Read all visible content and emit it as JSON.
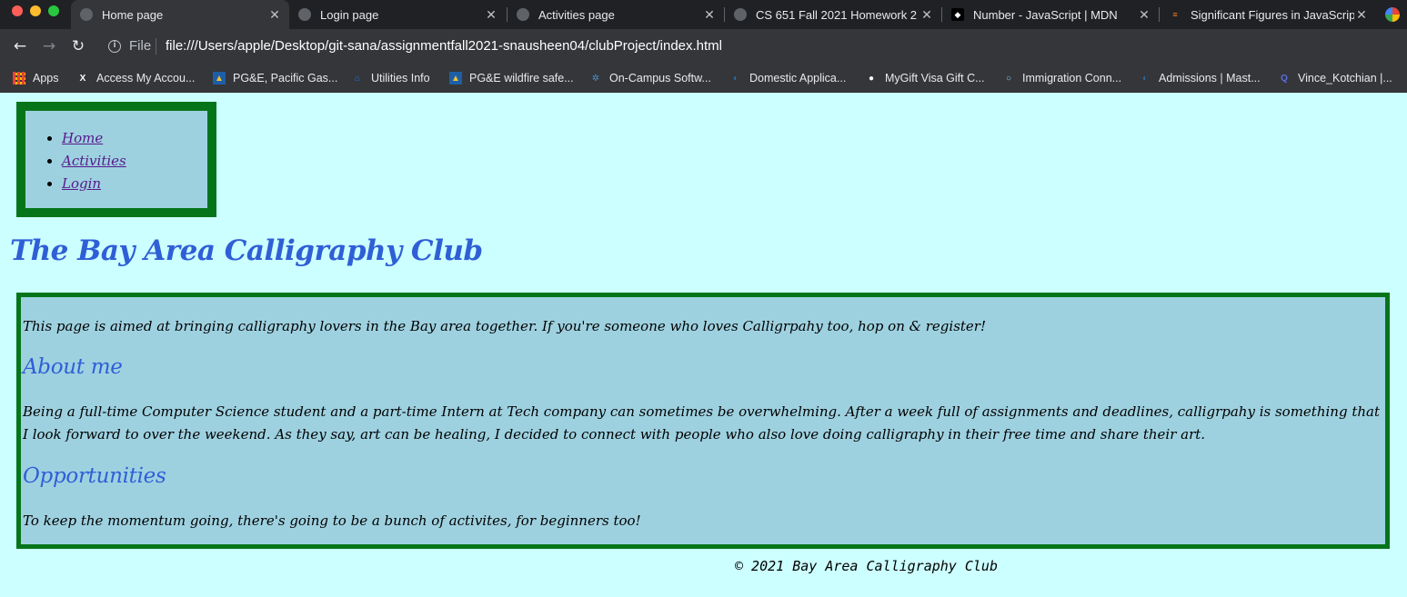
{
  "browser": {
    "tabs": [
      {
        "title": "Home page",
        "active": true
      },
      {
        "title": "Login page",
        "active": false
      },
      {
        "title": "Activities page",
        "active": false
      },
      {
        "title": "CS 651 Fall 2021 Homework 2",
        "active": false
      },
      {
        "title": "Number - JavaScript | MDN",
        "active": false
      },
      {
        "title": "Significant Figures in JavaScript",
        "active": false
      }
    ],
    "address": {
      "scheme_label": "File",
      "url": "file:///Users/apple/Desktop/git-sana/assignmentfall2021-snausheen04/clubProject/index.html"
    },
    "bookmarks": [
      {
        "label": "Apps",
        "icon": "apps-grid-icon"
      },
      {
        "label": "Access My Accou...",
        "icon": "x-logo-icon"
      },
      {
        "label": "PG&E, Pacific Gas...",
        "icon": "pge-icon"
      },
      {
        "label": "Utilities Info",
        "icon": "house-icon"
      },
      {
        "label": "PG&E wildfire safe...",
        "icon": "pge-icon"
      },
      {
        "label": "On-Campus Softw...",
        "icon": "network-icon"
      },
      {
        "label": "Domestic Applica...",
        "icon": "agency-logo-icon"
      },
      {
        "label": "MyGift Visa Gift C...",
        "icon": "globe-icon"
      },
      {
        "label": "Immigration Conn...",
        "icon": "circle-logo-icon"
      },
      {
        "label": "Admissions | Mast...",
        "icon": "agency-logo-icon"
      },
      {
        "label": "Vince_Kotchian |...",
        "icon": "q-logo-icon"
      }
    ]
  },
  "nav": {
    "items": [
      "Home",
      "Activities",
      "Login"
    ]
  },
  "site": {
    "title": "The Bay Area Calligraphy Club"
  },
  "main": {
    "intro": "This page is aimed at bringing calligraphy lovers in the Bay area together. If you're someone who loves Calligrpahy too, hop on & register!",
    "about_heading": "About me",
    "about_text": "Being a full-time Computer Science student and a part-time Intern at Tech company can sometimes be overwhelming. After a week full of assignments and deadlines, calligrpahy is something that I look forward to over the weekend. As they say, art can be healing, I decided to connect with people who also love doing calligraphy in their free time and share their art.",
    "opp_heading": "Opportunities",
    "opp_text": "To keep the momentum going, there's going to be a bunch of activites, for beginners too!"
  },
  "footer": {
    "text": "© 2021 Bay Area Calligraphy Club"
  },
  "colors": {
    "page_bg": "#ccffff",
    "box_bg": "#9ed1e0",
    "box_border": "#06751a",
    "heading": "#2f5fd6",
    "link": "#551a8b"
  }
}
